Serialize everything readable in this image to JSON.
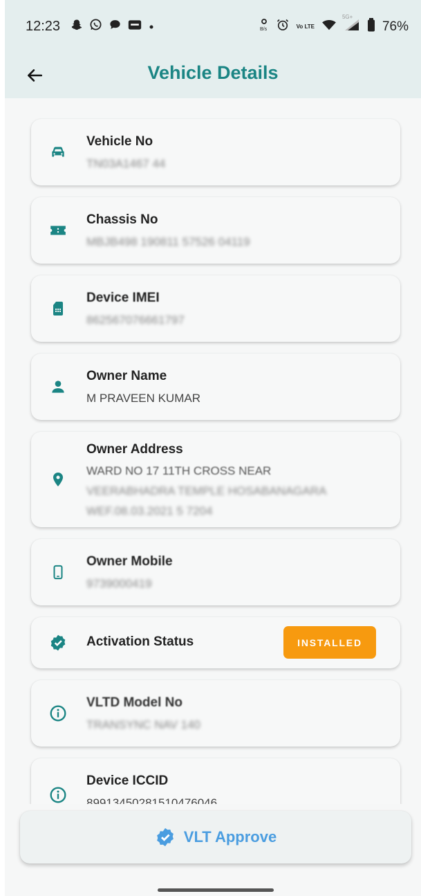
{
  "status_bar": {
    "time": "12:23",
    "left_icons": [
      "snapchat-icon",
      "whatsapp-icon",
      "chat-icon",
      "paytm-icon",
      "dot-icon"
    ],
    "right_icons": [
      "data-saver-icon",
      "alarm-icon",
      "volte-icon",
      "wifi-icon",
      "signal-icon",
      "battery-icon"
    ],
    "network_label": "Vo LTE",
    "signal_label": "5G+",
    "battery": "76%"
  },
  "app_bar": {
    "title": "Vehicle Details",
    "back_icon": "arrow-back-icon"
  },
  "colors": {
    "accent": "#1b8584",
    "status_badge": "#f79a0f",
    "approve_text": "#4a9de0",
    "header_bg": "#e4eeee"
  },
  "details": {
    "vehicle_no": {
      "label": "Vehicle No",
      "value": "TN03A1467 44",
      "icon": "car-icon"
    },
    "chassis_no": {
      "label": "Chassis No",
      "value": "MBJB498 190811 57526 04119",
      "icon": "ticket-icon"
    },
    "device_imei": {
      "label": "Device IMEI",
      "value": "862567076661797",
      "icon": "sim-card-icon"
    },
    "owner_name": {
      "label": "Owner Name",
      "value": "M PRAVEEN KUMAR",
      "icon": "person-icon"
    },
    "owner_address": {
      "label": "Owner Address",
      "lines": [
        "WARD NO 17 11TH CROSS NEAR",
        "VEERABHADRA TEMPLE HOSABANAGARA",
        "WEF.08.03.2021 5 7204"
      ],
      "icon": "location-pin-icon"
    },
    "owner_mobile": {
      "label": "Owner Mobile",
      "value": "9739000419",
      "icon": "smartphone-icon"
    },
    "activation_status": {
      "label": "Activation Status",
      "badge": "INSTALLED",
      "icon": "verified-icon"
    },
    "vltd_model_no": {
      "label": "VLTD Model No",
      "value": "TRANSYNC NAV 140",
      "icon": "info-icon"
    },
    "device_iccid": {
      "label": "Device ICCID",
      "value": "89913450281510476046",
      "icon": "info-icon"
    }
  },
  "approve_button": {
    "label": "VLT Approve",
    "icon": "verified-icon"
  }
}
